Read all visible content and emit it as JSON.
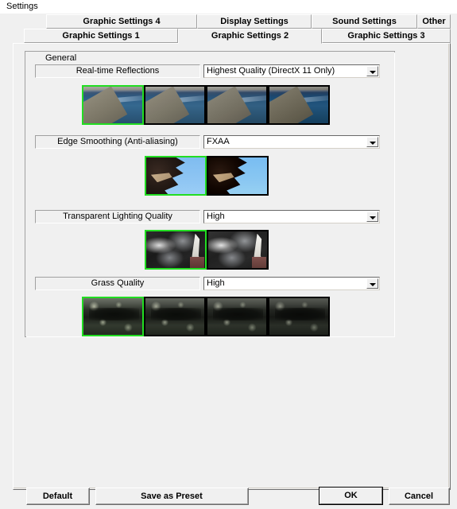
{
  "window": {
    "title": "Settings"
  },
  "tabs": {
    "top_row": [
      {
        "label": "Graphic Settings 4",
        "selected": false
      },
      {
        "label": "Display Settings",
        "selected": false
      },
      {
        "label": "Sound Settings",
        "selected": false
      },
      {
        "label": "Other",
        "selected": false
      }
    ],
    "bottom_row": [
      {
        "label": "Graphic Settings 1",
        "selected": false
      },
      {
        "label": "Graphic Settings 2",
        "selected": true
      },
      {
        "label": "Graphic Settings 3",
        "selected": false
      }
    ]
  },
  "group": {
    "legend": "General"
  },
  "settings": [
    {
      "label": "Real-time Reflections",
      "value": "Highest Quality (DirectX 11 Only)",
      "thumbnails": 4,
      "selected_index": 0
    },
    {
      "label": "Edge Smoothing (Anti-aliasing)",
      "value": "FXAA",
      "thumbnails": 2,
      "selected_index": 0
    },
    {
      "label": "Transparent Lighting Quality",
      "value": "High",
      "thumbnails": 2,
      "selected_index": 0
    },
    {
      "label": "Grass Quality",
      "value": "High",
      "thumbnails": 4,
      "selected_index": 0
    }
  ],
  "buttons": {
    "default": "Default",
    "save_as_preset": "Save as Preset",
    "ok": "OK",
    "cancel": "Cancel"
  },
  "colors": {
    "selection_green": "#22dd22",
    "dialog_face": "#f0f0f0",
    "thumb_border": "#000000"
  }
}
